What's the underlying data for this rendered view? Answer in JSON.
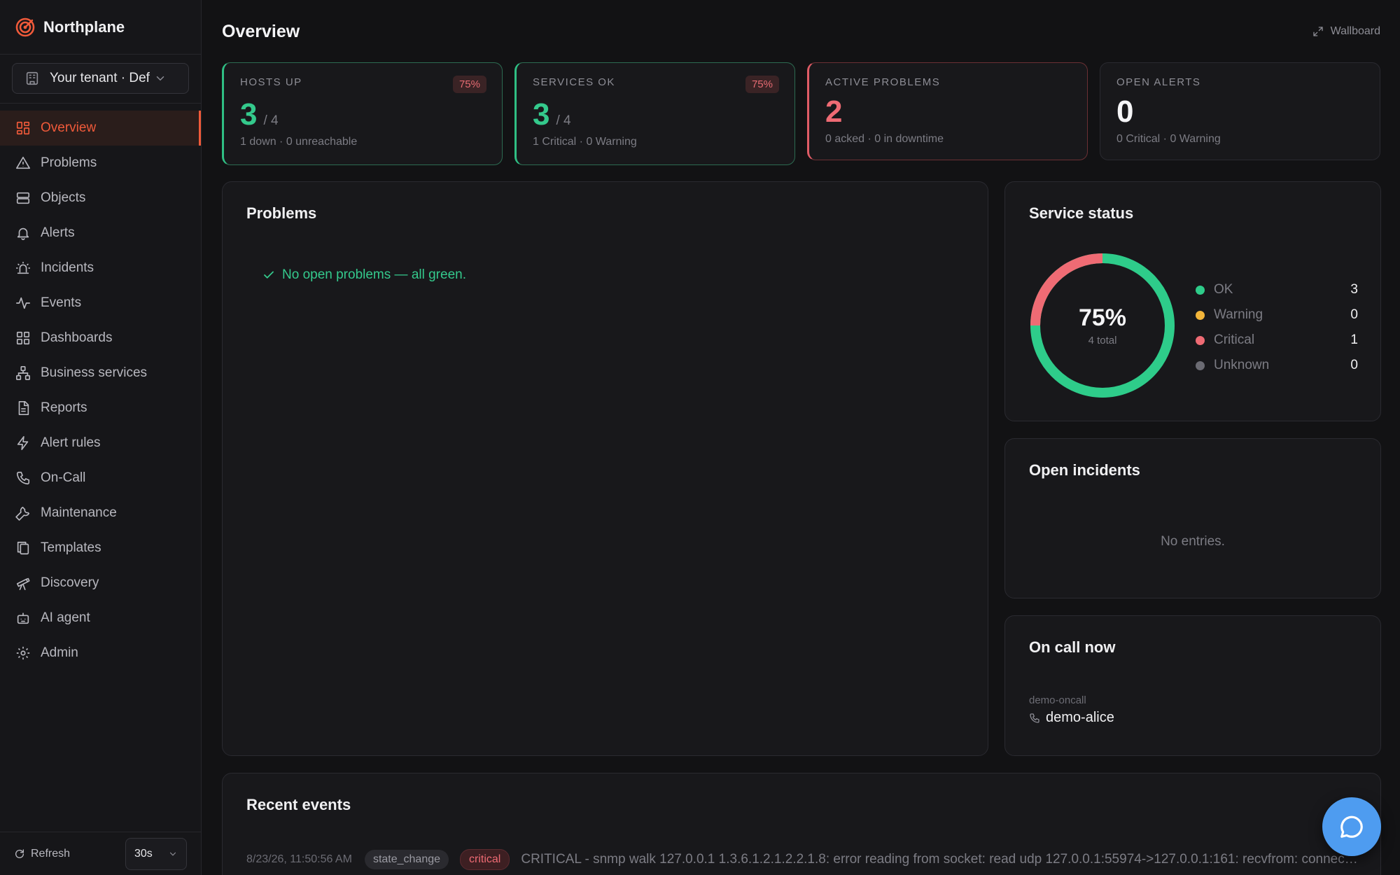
{
  "app": {
    "name": "Northplane"
  },
  "tenant": {
    "label": "Your tenant · Def"
  },
  "nav": [
    {
      "label": "Overview",
      "icon": "dashboard-grid-icon"
    },
    {
      "label": "Problems",
      "icon": "warning-triangle-icon"
    },
    {
      "label": "Objects",
      "icon": "server-icon"
    },
    {
      "label": "Alerts",
      "icon": "bell-icon"
    },
    {
      "label": "Incidents",
      "icon": "siren-icon"
    },
    {
      "label": "Events",
      "icon": "activity-icon"
    },
    {
      "label": "Dashboards",
      "icon": "grid-icon"
    },
    {
      "label": "Business services",
      "icon": "network-icon"
    },
    {
      "label": "Reports",
      "icon": "document-icon"
    },
    {
      "label": "Alert rules",
      "icon": "lightning-icon"
    },
    {
      "label": "On-Call",
      "icon": "phone-icon"
    },
    {
      "label": "Maintenance",
      "icon": "wrench-icon"
    },
    {
      "label": "Templates",
      "icon": "copy-icon"
    },
    {
      "label": "Discovery",
      "icon": "telescope-icon"
    },
    {
      "label": "AI agent",
      "icon": "robot-icon"
    },
    {
      "label": "Admin",
      "icon": "gear-icon"
    }
  ],
  "footer": {
    "refresh_label": "Refresh",
    "interval": "30s"
  },
  "header": {
    "title": "Overview",
    "wallboard_label": "Wallboard"
  },
  "stats": {
    "hosts": {
      "label": "HOSTS UP",
      "value": "3",
      "of": "/ 4",
      "badge": "75%",
      "sub": "1 down · 0 unreachable"
    },
    "services": {
      "label": "SERVICES OK",
      "value": "3",
      "of": "/ 4",
      "badge": "75%",
      "sub": "1 Critical · 0 Warning"
    },
    "problems": {
      "label": "ACTIVE PROBLEMS",
      "value": "2",
      "sub": "0 acked · 0 in downtime"
    },
    "alerts": {
      "label": "OPEN ALERTS",
      "value": "0",
      "sub": "0 Critical · 0 Warning"
    }
  },
  "problems_card": {
    "title": "Problems",
    "empty_text": "No open problems — all green."
  },
  "service_status": {
    "title": "Service status",
    "percent": "75%",
    "total_label": "4 total",
    "legend": [
      {
        "name": "OK",
        "count": "3",
        "color": "#2ecc8a"
      },
      {
        "name": "Warning",
        "count": "0",
        "color": "#f2b53a"
      },
      {
        "name": "Critical",
        "count": "1",
        "color": "#ef6b74"
      },
      {
        "name": "Unknown",
        "count": "0",
        "color": "#6b6b73"
      }
    ]
  },
  "incidents_card": {
    "title": "Open incidents",
    "empty_text": "No entries."
  },
  "oncall_card": {
    "title": "On call now",
    "schedule": "demo-oncall",
    "person": "demo-alice"
  },
  "events_card": {
    "title": "Recent events",
    "rows": [
      {
        "time": "8/23/26, 11:50:56 AM",
        "type": "state_change",
        "severity": "critical",
        "message": "CRITICAL - snmp walk 127.0.0.1 1.3.6.1.2.1.2.2.1.8: error reading from socket: read udp 127.0.0.1:55974->127.0.0.1:161: recvfrom: connection refused"
      }
    ]
  }
}
